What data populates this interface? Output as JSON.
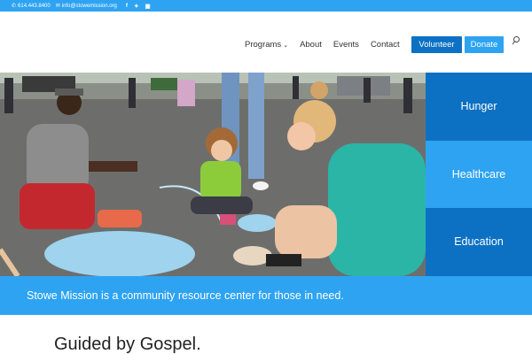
{
  "topbar": {
    "phone": "614.443.8400",
    "email": "info@stowemission.org",
    "social_icons": [
      "facebook-icon",
      "twitter-icon",
      "instagram-icon"
    ]
  },
  "nav": {
    "items": [
      {
        "label": "Programs",
        "has_dropdown": true
      },
      {
        "label": "About"
      },
      {
        "label": "Events"
      },
      {
        "label": "Contact"
      }
    ],
    "volunteer_label": "Volunteer",
    "donate_label": "Donate"
  },
  "tiles": [
    {
      "label": "Hunger"
    },
    {
      "label": "Healthcare"
    },
    {
      "label": "Education"
    }
  ],
  "banner": {
    "text": "Stowe Mission is a community resource center for those in need."
  },
  "section": {
    "title": "Guided by Gospel."
  },
  "colors": {
    "accent_light": "#2ea3f2",
    "accent_dark": "#0c71c3"
  }
}
